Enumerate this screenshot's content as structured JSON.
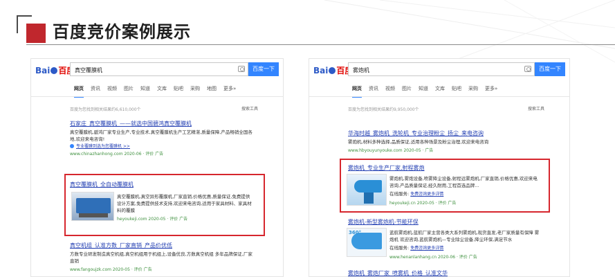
{
  "page": {
    "title": "百度竞价案例展示"
  },
  "colors": {
    "accent_red": "#c0272d",
    "baidu_blue": "#3385ff",
    "link_blue": "#2440b3",
    "highlight_red": "#d6262d"
  },
  "logo": {
    "part1": "Bai",
    "part3": "百度"
  },
  "left": {
    "query": "真空覆膜机",
    "search_button": "百度一下",
    "tabs": [
      "网页",
      "资讯",
      "视频",
      "图片",
      "知道",
      "文库",
      "贴吧",
      "采购",
      "地图",
      "更多»"
    ],
    "result_count": "百度为您找到相关结果约6,610,000个",
    "search_tools": "搜索工具",
    "r1": {
      "title": "石家庄_真空覆膜机_——就选中国碧鸿真空覆膜机",
      "snippet": "真空覆膜机,碧鸿厂家专业生产,专业技术,真空覆膜机生产工艺精湛,质量保障,产品畅销全国各地,欢迎来电咨询!",
      "sub_link": "专业覆膜到选为您覆膜机 >>",
      "meta": "www.chinazhanhong.com  2020-06  ·  评价  广告"
    },
    "r2": {
      "title": "真空覆膜机_全自动覆膜机",
      "snippet": "真空覆膜机,真空异形覆膜机,厂家直销,价格优惠,质量保证,免费提供设计方案,免费提供技术支持,欢迎来电咨询,适用于家具材料、家具材料的覆膜",
      "meta": "heyoukeji.com  2020-05  ·  评价  广告"
    },
    "r3": {
      "title": "真空机组_认准方数_厂家直销_产品价优低",
      "snippet": "方数专业研发制造真空机组,真空机组用于机组上,设备优良,方数真空机组 多年品牌保证,厂家直销",
      "meta": "www.fangoujzk.com  2020-05  ·  评价  广告"
    }
  },
  "right": {
    "query": "雾炮机",
    "search_button": "百度一下",
    "tabs": [
      "网页",
      "资讯",
      "视频",
      "图片",
      "知道",
      "文库",
      "贴吧",
      "采购",
      "更多»"
    ],
    "result_count": "百度为您找到相关结果约9,950,000个",
    "search_tools": "搜索工具",
    "r1": {
      "title": "华海时越_雾炮机_洗轮机_专业治理粉尘_扬尘_来电咨询",
      "snippet": "雾炮机,材料多种选择,品质保证,适用各种场景及粉尘治理,欢迎来电咨询",
      "meta": "www.hbyouyunyouke.com  2020-05  ·  广告"
    },
    "r2": {
      "title": "雾炮机_专业生产厂家,射程雾炮",
      "snippet": "雾炮机,雾炮设备,喷雾降尘设备,射程远雾炮机,厂家直销,价格优惠,欢迎来电咨询,产品质量保证,经久耐用,工程首选品牌...",
      "service_label": "在线服务:",
      "service_link": "免费咨询更多详情",
      "meta": "heyoukeji.cn  2020-05  ·  评价  广告"
    },
    "r3": {
      "title": "雾炮机-新型雾炮机-节能环保",
      "snippet": "蓝航雾炮机,蓝航厂家主营各类大系列雾炮机,现货直发,老厂家质量有保障 雾炮机 欢迎咨询,蓝航雾炮机—专业除尘设备,降尘环保,满足节水",
      "service_label": "在线服务:",
      "service_link": "免费咨询更多详情",
      "meta": "www.henanlanhang.cn  2020-06  ·  评价  广告",
      "badge": "360°"
    },
    "r4": {
      "title": "雾炮机_雾炮厂家_喷雾机_价格_认准文华",
      "meta": ""
    }
  }
}
